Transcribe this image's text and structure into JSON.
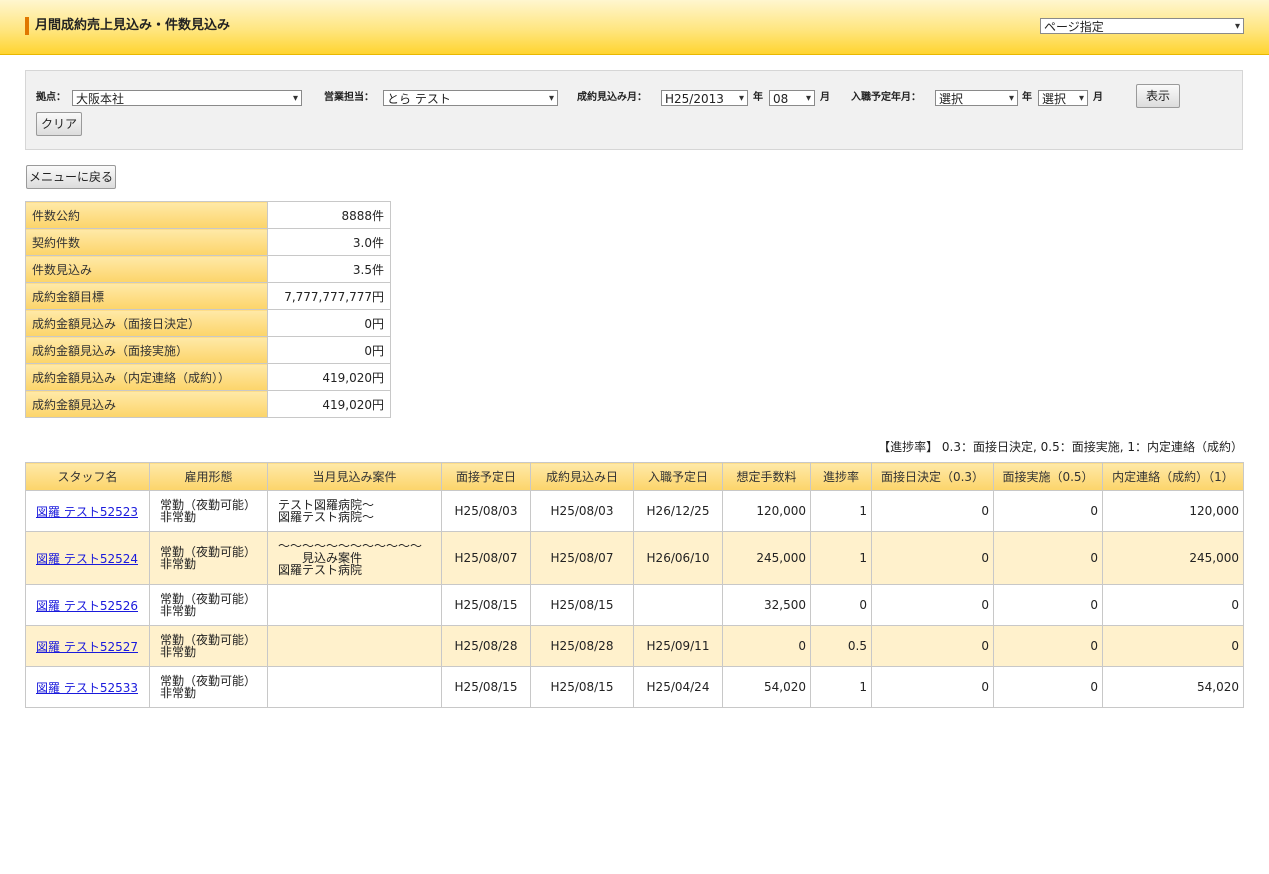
{
  "header": {
    "title": "月間成約売上見込み・件数見込み",
    "page_select": "ページ指定"
  },
  "filters": {
    "base_label": "拠点：",
    "base_value": "大阪本社",
    "staff_label": "営業担当：",
    "staff_value": "とら テスト",
    "month_label": "成約見込み月：",
    "year_value": "H25/2013",
    "year_unit": "年",
    "month_value": "08",
    "month_unit": "月",
    "join_label": "入職予定年月：",
    "join_year_value": "選択",
    "join_year_unit": "年",
    "join_month_value": "選択",
    "join_month_unit": "月",
    "show_button": "表示",
    "clear_button": "クリア"
  },
  "menu_button": "メニューに戻る",
  "summary": [
    {
      "label": "件数公約",
      "value": "8888件"
    },
    {
      "label": "契約件数",
      "value": "3.0件"
    },
    {
      "label": "件数見込み",
      "value": "3.5件"
    },
    {
      "label": "成約金額目標",
      "value": "7,777,777,777円"
    },
    {
      "label": "成約金額見込み（面接日決定）",
      "value": "0円"
    },
    {
      "label": "成約金額見込み（面接実施）",
      "value": "0円"
    },
    {
      "label": "成約金額見込み（内定連絡（成約））",
      "value": "419,020円"
    },
    {
      "label": "成約金額見込み",
      "value": "419,020円"
    }
  ],
  "progress_note": "【進捗率】 0.3：面接日決定, 0.5：面接実施, 1：内定連絡（成約）",
  "table": {
    "headers": [
      "スタッフ名",
      "雇用形態",
      "当月見込み案件",
      "面接予定日",
      "成約見込み日",
      "入職予定日",
      "想定手数料",
      "進捗率",
      "面接日決定（0.3）",
      "面接実施（0.5）",
      "内定連絡（成約）（1）"
    ],
    "rows": [
      {
        "name": "図羅 テスト52523",
        "emp1": "常勤（夜勤可能）",
        "emp2": "非常勤",
        "case1": "テスト図羅病院～",
        "case2": "図羅テスト病院～",
        "case3": "",
        "interview": "H25/08/03",
        "contract": "H25/08/03",
        "join": "H26/12/25",
        "fee": "120,000",
        "rate": "1",
        "c1": "0",
        "c2": "0",
        "c3": "120,000"
      },
      {
        "name": "図羅 テスト52524",
        "emp1": "常勤（夜勤可能）",
        "emp2": "非常勤",
        "case1": "～～～～～～～～～～～～",
        "case2": "　　見込み案件",
        "case3": "図羅テスト病院",
        "interview": "H25/08/07",
        "contract": "H25/08/07",
        "join": "H26/06/10",
        "fee": "245,000",
        "rate": "1",
        "c1": "0",
        "c2": "0",
        "c3": "245,000"
      },
      {
        "name": "図羅 テスト52526",
        "emp1": "常勤（夜勤可能）",
        "emp2": "非常勤",
        "case1": "",
        "case2": "",
        "case3": "",
        "interview": "H25/08/15",
        "contract": "H25/08/15",
        "join": "",
        "fee": "32,500",
        "rate": "0",
        "c1": "0",
        "c2": "0",
        "c3": "0"
      },
      {
        "name": "図羅 テスト52527",
        "emp1": "常勤（夜勤可能）",
        "emp2": "非常勤",
        "case1": "",
        "case2": "",
        "case3": "",
        "interview": "H25/08/28",
        "contract": "H25/08/28",
        "join": "H25/09/11",
        "fee": "0",
        "rate": "0.5",
        "c1": "0",
        "c2": "0",
        "c3": "0"
      },
      {
        "name": "図羅 テスト52533",
        "emp1": "常勤（夜勤可能）",
        "emp2": "非常勤",
        "case1": "",
        "case2": "",
        "case3": "",
        "interview": "H25/08/15",
        "contract": "H25/08/15",
        "join": "H25/04/24",
        "fee": "54,020",
        "rate": "1",
        "c1": "0",
        "c2": "0",
        "c3": "54,020"
      }
    ]
  }
}
